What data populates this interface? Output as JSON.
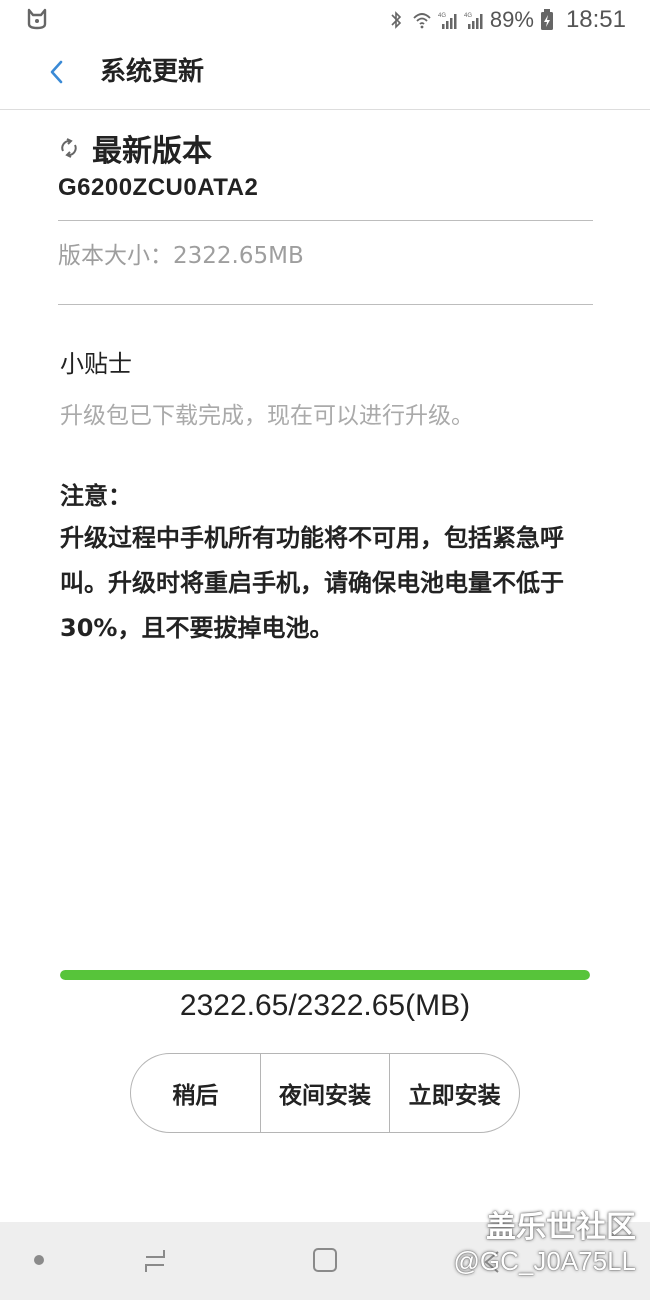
{
  "status_bar": {
    "battery_percent": "89%",
    "time": "18:51",
    "network_labels": [
      "4G",
      "4G"
    ]
  },
  "app_bar": {
    "title": "系统更新"
  },
  "version": {
    "heading": "最新版本",
    "code": "G6200ZCU0ATA2",
    "size_label": "版本大小：2322.65MB"
  },
  "tips": {
    "title": "小贴士",
    "text": "升级包已下载完成，现在可以进行升级。"
  },
  "notice": {
    "title": "注意：",
    "text": "升级过程中手机所有功能将不可用，包括紧急呼叫。升级时将重启手机，请确保电池电量不低于30%，且不要拔掉电池。"
  },
  "progress": {
    "fraction": 1.0,
    "text": "2322.65/2322.65(MB)",
    "color": "#57c43a"
  },
  "buttons": {
    "later": "稍后",
    "night_install": "夜间安装",
    "install_now": "立即安装"
  },
  "watermark": {
    "line1": "盖乐世社区",
    "line2": "@GC_J0A75LL"
  },
  "icons": {
    "status_left": "cat-notification-icon",
    "bluetooth": "bluetooth-icon",
    "wifi": "wifi-icon",
    "battery": "battery-icon",
    "back": "chevron-left-icon",
    "refresh": "refresh-icon"
  }
}
